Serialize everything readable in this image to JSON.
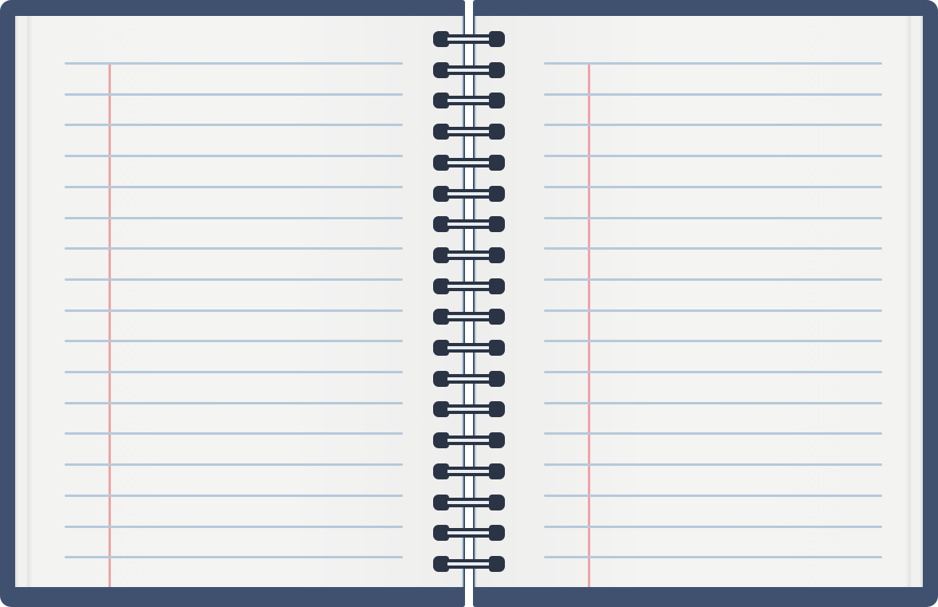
{
  "notebook": {
    "type": "spiral-bound lined notebook, open",
    "colors": {
      "cover": "#40516f",
      "rule": "#b6c9d9",
      "margin": "#f0a3a6",
      "ring": "#2b3445",
      "spine": "#b3c6d6",
      "paper": "#f3f3f2"
    },
    "pages": [
      {
        "side": "left",
        "rule_count": 17,
        "has_margin_line": true
      },
      {
        "side": "right",
        "rule_count": 17,
        "has_margin_line": true
      }
    ],
    "binding": {
      "ring_count": 18
    }
  }
}
